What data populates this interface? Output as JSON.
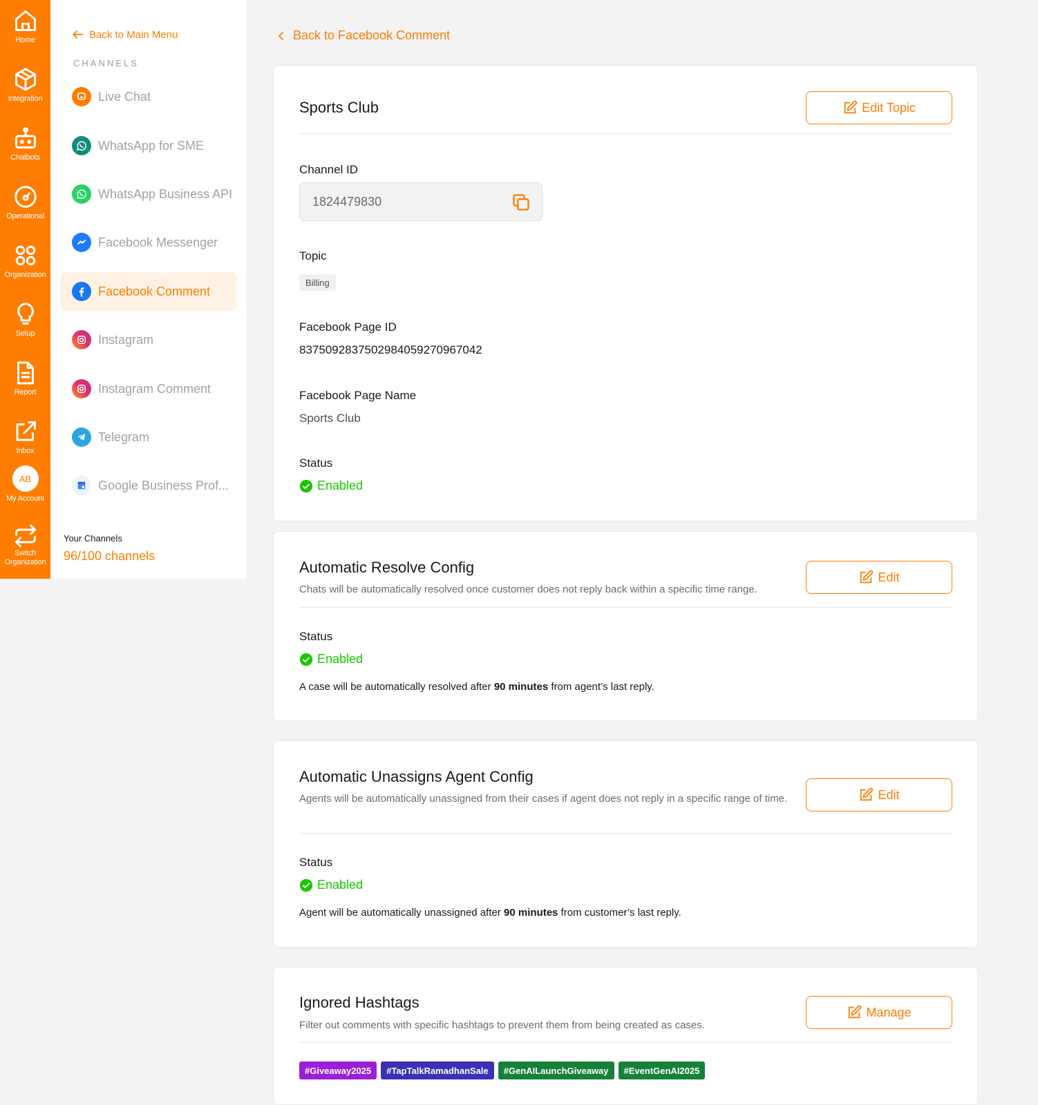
{
  "rail": {
    "items": [
      {
        "label": "Home",
        "icon": "home-icon"
      },
      {
        "label": "Integration",
        "icon": "cube-icon"
      },
      {
        "label": "Chatbots",
        "icon": "robot-icon"
      },
      {
        "label": "Operational",
        "icon": "gauge-icon"
      },
      {
        "label": "Organization",
        "icon": "grid-icon"
      },
      {
        "label": "Setup",
        "icon": "bulb-icon"
      },
      {
        "label": "Report",
        "icon": "document-icon"
      },
      {
        "label": "Inbox",
        "icon": "external-link-icon"
      }
    ],
    "account": {
      "initials": "AB",
      "label": "My Account"
    },
    "switch": {
      "label_1": "Switch",
      "label_2": "Organization"
    },
    "accent": "#ff7d00"
  },
  "sidebar": {
    "back_label": "Back to Main Menu",
    "heading": "CHANNELS",
    "channels": [
      {
        "label": "Live Chat",
        "icon": "livechat-icon",
        "color": "#ff7d00"
      },
      {
        "label": "WhatsApp for SME",
        "icon": "whatsapp-sme-icon",
        "color": "#128c7e"
      },
      {
        "label": "WhatsApp Business API",
        "icon": "whatsapp-icon",
        "color": "#25d366"
      },
      {
        "label": "Facebook Messenger",
        "icon": "messenger-icon",
        "color": "#1d7bff"
      },
      {
        "label": "Facebook Comment",
        "icon": "facebook-icon",
        "color": "#1877f2"
      },
      {
        "label": "Instagram",
        "icon": "instagram-icon",
        "color": "#e1306c"
      },
      {
        "label": "Instagram Comment",
        "icon": "instagram-comment-icon",
        "color": "#e1306c"
      },
      {
        "label": "Telegram",
        "icon": "telegram-icon",
        "color": "#2ca5e0"
      },
      {
        "label": "Google Business Prof...",
        "icon": "google-business-icon",
        "color": "#4285f4"
      }
    ],
    "your_channels_label": "Your Channels",
    "channel_count": "96/100 channels"
  },
  "main": {
    "back_label": "Back to Facebook Comment",
    "info_card": {
      "title": "Sports Club",
      "edit_label": "Edit Topic",
      "channel_id_label": "Channel ID",
      "channel_id": "1824479830",
      "topic_label": "Topic",
      "topic": "Billing",
      "page_id_label": "Facebook Page ID",
      "page_id": "8375092837502984059270967042",
      "page_name_label": "Facebook Page Name",
      "page_name": "Sports Club",
      "status_label": "Status",
      "status": "Enabled"
    },
    "resolve_card": {
      "title": "Automatic Resolve Config",
      "desc": "Chats will be automatically resolved once customer does not reply back within a specific time range.",
      "edit_label": "Edit",
      "status_label": "Status",
      "status": "Enabled",
      "note_pre": "A case will be automatically resolved after ",
      "note_bold": "90 minutes",
      "note_post": " from agent’s last reply."
    },
    "unassign_card": {
      "title": "Automatic Unassigns Agent Config",
      "desc": "Agents will be automatically unassigned from their cases if agent does not reply in a specific range of time.",
      "edit_label": "Edit",
      "status_label": "Status",
      "status": "Enabled",
      "note_pre": "Agent will be automatically unassigned after ",
      "note_bold": "90 minutes",
      "note_post": " from customer’s last reply."
    },
    "hashtag_card": {
      "title": "Ignored Hashtags",
      "desc": "Filter out comments with specific hashtags to prevent them from being created as cases.",
      "manage_label": "Manage",
      "tags": [
        {
          "label": "#Giveaway2025",
          "color": "#9b1fd9"
        },
        {
          "label": "#TapTalkRamadhanSale",
          "color": "#3c2fb8"
        },
        {
          "label": "#GenAILaunchGiveaway",
          "color": "#17813a"
        },
        {
          "label": "#EventGenAI2025",
          "color": "#17813a"
        }
      ]
    }
  },
  "colors": {
    "accent": "#ff7d00",
    "enabled": "#19c700",
    "background": "#f3f3f3"
  }
}
